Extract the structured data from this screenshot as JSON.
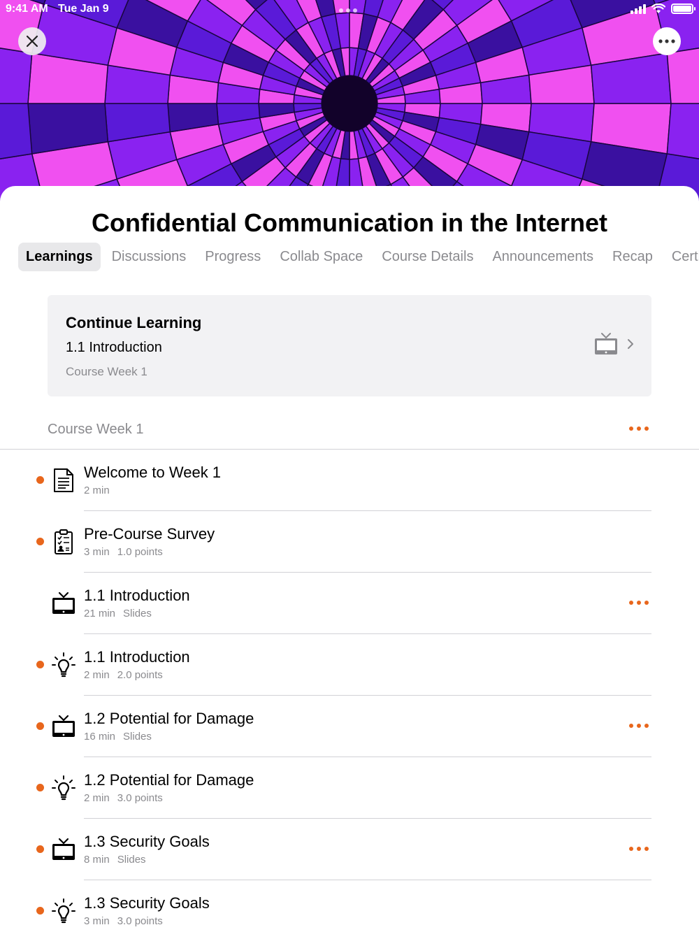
{
  "status_bar": {
    "time": "9:41 AM",
    "date": "Tue Jan 9"
  },
  "header": {
    "close_icon": "close-icon",
    "more_icon": "more-icon"
  },
  "course": {
    "title": "Confidential Communication in the Internet"
  },
  "tabs": [
    {
      "label": "Learnings",
      "active": true
    },
    {
      "label": "Discussions"
    },
    {
      "label": "Progress"
    },
    {
      "label": "Collab Space"
    },
    {
      "label": "Course Details"
    },
    {
      "label": "Announcements"
    },
    {
      "label": "Recap"
    },
    {
      "label": "Certifi"
    }
  ],
  "continue_learning": {
    "heading": "Continue Learning",
    "item": "1.1 Introduction",
    "week": "Course Week 1",
    "icon": "tv-icon"
  },
  "section": {
    "title": "Course Week 1"
  },
  "items": [
    {
      "title": "Welcome to Week 1",
      "meta": [
        "2 min"
      ],
      "icon": "document-icon",
      "unread": true,
      "has_more": false
    },
    {
      "title": "Pre-Course Survey",
      "meta": [
        "3 min",
        "1.0 points"
      ],
      "icon": "survey-icon",
      "unread": true,
      "has_more": false
    },
    {
      "title": "1.1 Introduction",
      "meta": [
        "21 min",
        "Slides"
      ],
      "icon": "tv-icon",
      "unread": false,
      "has_more": true
    },
    {
      "title": "1.1 Introduction",
      "meta": [
        "2 min",
        "2.0 points"
      ],
      "icon": "lightbulb-icon",
      "unread": true,
      "has_more": false
    },
    {
      "title": "1.2 Potential for Damage",
      "meta": [
        "16 min",
        "Slides"
      ],
      "icon": "tv-icon",
      "unread": true,
      "has_more": true
    },
    {
      "title": "1.2 Potential for Damage",
      "meta": [
        "2 min",
        "3.0 points"
      ],
      "icon": "lightbulb-icon",
      "unread": true,
      "has_more": false
    },
    {
      "title": "1.3 Security Goals",
      "meta": [
        "8 min",
        "Slides"
      ],
      "icon": "tv-icon",
      "unread": true,
      "has_more": true
    },
    {
      "title": "1.3 Security Goals",
      "meta": [
        "3 min",
        "3.0 points"
      ],
      "icon": "lightbulb-icon",
      "unread": true,
      "has_more": false
    }
  ],
  "colors": {
    "accent": "#e8661c",
    "secondary_text": "#8a8a8e",
    "card_bg": "#f2f2f4"
  }
}
